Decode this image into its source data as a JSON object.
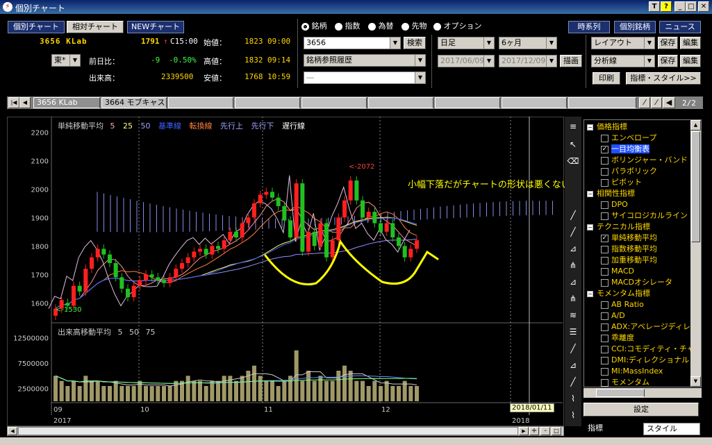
{
  "window": {
    "title": "個別チャート",
    "btn_help": "?",
    "btn_min": "_",
    "btn_max": "□",
    "btn_close": "✕",
    "btn_t": "T"
  },
  "nav": {
    "tab1": "個別チャート",
    "tab2": "相対チャート",
    "tab3": "NEWチャート"
  },
  "quote": {
    "code_name": "3656 KLab",
    "price": "1791",
    "arrow": "↑",
    "c_time": "C15:00",
    "market": "東*",
    "prev_label": "前日比：",
    "change": "-9",
    "change_pct": "-0.50%",
    "volume_label": "出来高：",
    "volume": "2339500",
    "open_label": "始値：",
    "open": "1823",
    "open_time": "09:00",
    "high_label": "高値：",
    "high": "1832",
    "high_time": "09:14",
    "low_label": "安値：",
    "low": "1768",
    "low_time": "10:59"
  },
  "asset_types": [
    "銘柄",
    "指数",
    "為替",
    "先物",
    "オプション"
  ],
  "search": {
    "code": "3656",
    "button": "検索",
    "history": "銘柄参照履歴",
    "third": "―"
  },
  "period": {
    "interval": "日足",
    "span": "6ヶ月",
    "from": "2017/06/09",
    "to": "2017/12/09",
    "draw": "描画"
  },
  "right_buttons": {
    "timeseries": "時系列",
    "individual": "個別銘柄",
    "news": "ニュース",
    "layout": "レイアウト",
    "save": "保存",
    "edit": "編集",
    "analysis": "分析線",
    "save2": "保存",
    "edit2": "編集",
    "print": "印刷",
    "indicator_style": "指標・スタイル>>"
  },
  "symbol_tabs": {
    "tab1": "3656 KLab",
    "tab2": "3664 モブキャス",
    "page": "2/2"
  },
  "legend": {
    "sma": "単純移動平均",
    "p5": "5",
    "p25": "25",
    "p50": "50",
    "kijun": "基準線",
    "tenkan": "転換線",
    "senko_a": "先行上",
    "senko_b": "先行下",
    "chikou": "遅行線"
  },
  "vol_legend": {
    "label": "出来高移動平均",
    "p5": "5",
    "p50": "50",
    "p75": "75"
  },
  "annotation": "小幅下落だがチャートの形状は悪くない。",
  "labels": {
    "high_mark": "<-2072",
    "low_mark": "<-1530",
    "date_box": "2018/01/11"
  },
  "colors": {
    "up": "#ff2020",
    "down": "#20c020",
    "cloud": "#8a8ae8",
    "annot": "#ffff00"
  },
  "chart_data": {
    "type": "line",
    "y_ticks": [
      "2200",
      "2100",
      "2000",
      "1900",
      "1800",
      "1700",
      "1600"
    ],
    "vol_ticks": [
      "12500000",
      "7500000",
      "2500000"
    ],
    "x_months": [
      "09",
      "10",
      "11",
      "12"
    ],
    "x_years": [
      "2017",
      "2018"
    ],
    "ylim": [
      1530,
      2200
    ],
    "candles": [
      {
        "o": 1555,
        "c": 1580
      },
      {
        "o": 1580,
        "c": 1610
      },
      {
        "o": 1600,
        "c": 1590
      },
      {
        "o": 1590,
        "c": 1660
      },
      {
        "o": 1660,
        "c": 1640
      },
      {
        "o": 1640,
        "c": 1720
      },
      {
        "o": 1720,
        "c": 1760
      },
      {
        "o": 1760,
        "c": 1790
      },
      {
        "o": 1790,
        "c": 1770
      },
      {
        "o": 1770,
        "c": 1740
      },
      {
        "o": 1740,
        "c": 1690
      },
      {
        "o": 1690,
        "c": 1650
      },
      {
        "o": 1650,
        "c": 1620
      },
      {
        "o": 1620,
        "c": 1660
      },
      {
        "o": 1660,
        "c": 1680
      },
      {
        "o": 1680,
        "c": 1700
      },
      {
        "o": 1700,
        "c": 1690
      },
      {
        "o": 1690,
        "c": 1680
      },
      {
        "o": 1680,
        "c": 1670
      },
      {
        "o": 1670,
        "c": 1690
      },
      {
        "o": 1690,
        "c": 1720
      },
      {
        "o": 1720,
        "c": 1740
      },
      {
        "o": 1740,
        "c": 1760
      },
      {
        "o": 1760,
        "c": 1780
      },
      {
        "o": 1780,
        "c": 1790
      },
      {
        "o": 1790,
        "c": 1770
      },
      {
        "o": 1770,
        "c": 1800
      },
      {
        "o": 1800,
        "c": 1790
      },
      {
        "o": 1790,
        "c": 1820
      },
      {
        "o": 1820,
        "c": 1850
      },
      {
        "o": 1850,
        "c": 1830
      },
      {
        "o": 1830,
        "c": 1880
      },
      {
        "o": 1880,
        "c": 1900
      },
      {
        "o": 1900,
        "c": 1950
      },
      {
        "o": 1950,
        "c": 1980
      },
      {
        "o": 1980,
        "c": 1990
      },
      {
        "o": 1990,
        "c": 1970
      },
      {
        "o": 1970,
        "c": 1940
      },
      {
        "o": 1940,
        "c": 1890
      },
      {
        "o": 1890,
        "c": 1830
      },
      {
        "o": 1830,
        "c": 2020
      },
      {
        "o": 2020,
        "c": 1780
      },
      {
        "o": 1780,
        "c": 1850
      },
      {
        "o": 1850,
        "c": 1800
      },
      {
        "o": 1800,
        "c": 1880
      },
      {
        "o": 1880,
        "c": 1760
      },
      {
        "o": 1760,
        "c": 1820
      },
      {
        "o": 1820,
        "c": 1900
      },
      {
        "o": 1900,
        "c": 1960
      },
      {
        "o": 1960,
        "c": 2030
      },
      {
        "o": 2030,
        "c": 1960
      },
      {
        "o": 1960,
        "c": 1900
      },
      {
        "o": 1900,
        "c": 1920
      },
      {
        "o": 1920,
        "c": 1880
      },
      {
        "o": 1880,
        "c": 1850
      },
      {
        "o": 1850,
        "c": 1880
      },
      {
        "o": 1880,
        "c": 1830
      },
      {
        "o": 1830,
        "c": 1800
      },
      {
        "o": 1800,
        "c": 1760
      },
      {
        "o": 1760,
        "c": 1790
      },
      {
        "o": 1790,
        "c": 1820
      }
    ],
    "volumes": [
      5,
      4,
      3,
      4,
      3,
      5,
      4,
      4,
      3,
      3,
      4,
      3,
      3,
      3,
      4,
      3,
      3,
      3,
      3,
      3,
      4,
      4,
      5,
      4,
      4,
      3,
      4,
      4,
      5,
      5,
      4,
      5,
      6,
      7,
      5,
      4,
      4,
      3,
      4,
      5,
      10,
      4,
      6,
      4,
      5,
      4,
      4,
      6,
      7,
      6,
      4,
      4,
      3,
      4,
      3,
      4,
      3,
      3,
      4,
      3,
      3
    ],
    "vol_max": 15000000
  },
  "sidebar": {
    "items": [
      {
        "type": "cat",
        "label": "価格指標"
      },
      {
        "type": "item",
        "label": "エンベロープ",
        "checked": false
      },
      {
        "type": "item",
        "label": "一目均衡表",
        "checked": true,
        "selected": true
      },
      {
        "type": "item",
        "label": "ボリンジャー・バンド",
        "checked": false
      },
      {
        "type": "item",
        "label": "パラボリック",
        "checked": false
      },
      {
        "type": "item",
        "label": "ピボット",
        "checked": false
      },
      {
        "type": "cat",
        "label": "相関性指標"
      },
      {
        "type": "item",
        "label": "DPO",
        "checked": false
      },
      {
        "type": "item",
        "label": "サイコロジカルライン",
        "checked": false
      },
      {
        "type": "cat",
        "label": "テクニカル指標"
      },
      {
        "type": "item",
        "label": "単純移動平均",
        "checked": true
      },
      {
        "type": "item",
        "label": "指数移動平均",
        "checked": false
      },
      {
        "type": "item",
        "label": "加重移動平均",
        "checked": false
      },
      {
        "type": "item",
        "label": "MACD",
        "checked": false
      },
      {
        "type": "item",
        "label": "MACDオシレータ",
        "checked": false
      },
      {
        "type": "cat",
        "label": "モメンタム指標"
      },
      {
        "type": "item",
        "label": "AB Ratio",
        "checked": false
      },
      {
        "type": "item",
        "label": "A/D",
        "checked": false
      },
      {
        "type": "item",
        "label": "ADX:アベレージディレ",
        "checked": false
      },
      {
        "type": "item",
        "label": "乖離度",
        "checked": false
      },
      {
        "type": "item",
        "label": "CCI:コモディティ・チャ",
        "checked": false
      },
      {
        "type": "item",
        "label": "DMI:ディレクショナル",
        "checked": false
      },
      {
        "type": "item",
        "label": "MI:MassIndex",
        "checked": false
      },
      {
        "type": "item",
        "label": "モメンタム",
        "checked": false
      }
    ],
    "settings": "設定",
    "tab_indicator": "指標",
    "tab_style": "スタイル"
  }
}
